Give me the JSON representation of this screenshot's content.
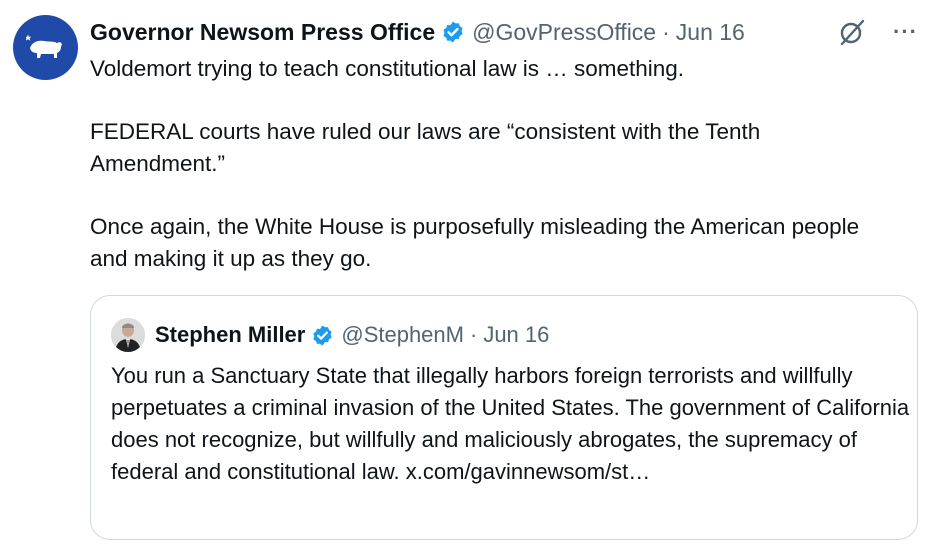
{
  "tweet": {
    "author_name": "Governor Newsom Press Office",
    "handle": "@GovPressOffice",
    "separator": "·",
    "date": "Jun 16",
    "paragraphs": [
      "Voldemort trying to teach constitutional law is … something.",
      "FEDERAL courts have ruled our laws are “consistent with the Tenth Amendment.”",
      "Once again, the White House is purposefully misleading the American people and making it up as they go."
    ],
    "more_label": "···",
    "icons": {
      "avatar": "california-bear-icon",
      "badge": "verified-badge-icon",
      "grok": "grok-icon",
      "more": "more-icon"
    }
  },
  "quote": {
    "author_name": "Stephen Miller",
    "handle": "@StephenM",
    "separator": "·",
    "date": "Jun 16",
    "text": "You run a Sanctuary State that illegally harbors foreign terrorists and willfully perpetuates a criminal invasion of the United States. The government of California does not recognize, but willfully and maliciously abrogates, the supremacy of federal and constitutional law. x.com/gavinnewsom/st…"
  },
  "colors": {
    "text": "#0f1419",
    "secondary": "#536471",
    "verified": "#1d9bf0",
    "avatar_bg": "#1f4aa8",
    "border": "#cfd9de"
  }
}
